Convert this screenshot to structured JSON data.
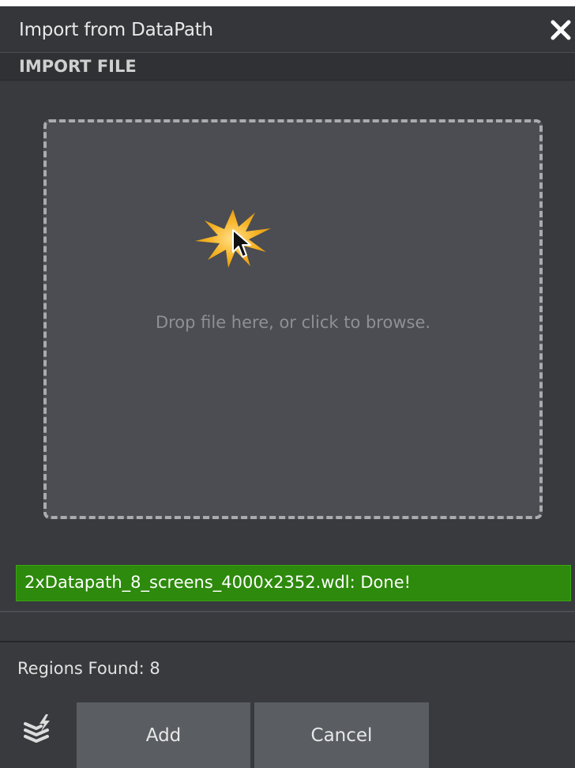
{
  "dialog": {
    "title": "Import from DataPath",
    "close_icon": "close-icon"
  },
  "section": {
    "title": "IMPORT FILE"
  },
  "dropzone": {
    "text": "Drop file here, or click to browse.",
    "icon": "drop-starburst-icon"
  },
  "status": {
    "text": "2xDatapath_8_screens_4000x2352.wdl: Done!",
    "color": "#2d8a0c"
  },
  "regions": {
    "text": "Regions Found: 8"
  },
  "footer": {
    "icon": "layers-lightning-icon",
    "add_label": "Add",
    "cancel_label": "Cancel"
  },
  "colors": {
    "background": "#383a3e",
    "dropzone": "#4b4d52",
    "button": "#5a5d62",
    "accent": "#f6b11f"
  }
}
